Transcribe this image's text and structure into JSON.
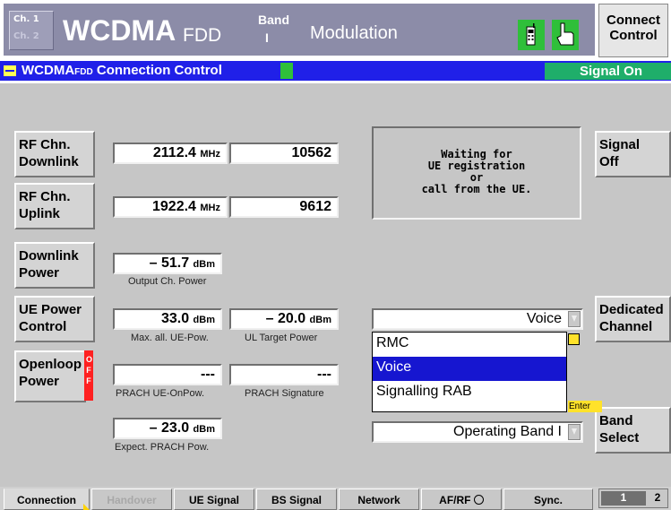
{
  "header": {
    "ch1": "Ch. 1",
    "ch2": "Ch. 2",
    "title": "WCDMA",
    "title_sub": "FDD",
    "band_label": "Band",
    "band_value": "I",
    "mode": "Modulation",
    "connect_control": "Connect Control"
  },
  "panel": {
    "title": "WCDMA",
    "title_fdd": "FDD",
    "title_rest": "Connection Control",
    "signal_state": "Signal On"
  },
  "left_buttons": {
    "rf_downlink": "RF Chn. Downlink",
    "rf_uplink": "RF Chn. Uplink",
    "downlink_power": "Downlink Power",
    "ue_power_control": "UE Power Control",
    "openloop_power": "Openloop Power",
    "openloop_state": "OFF"
  },
  "values": {
    "dl_freq": "2112.4",
    "dl_freq_unit": "MHz",
    "dl_chn": "10562",
    "ul_freq": "1922.4",
    "ul_freq_unit": "MHz",
    "ul_chn": "9612",
    "dl_power": "– 51.7",
    "dl_power_unit": "dBm",
    "dl_power_caption": "Output Ch. Power",
    "max_ue_pow": "33.0",
    "max_ue_pow_unit": "dBm",
    "max_ue_pow_caption": "Max. all. UE-Pow.",
    "ul_target": "– 20.0",
    "ul_target_unit": "dBm",
    "ul_target_caption": "UL Target Power",
    "prach_onpow": "---",
    "prach_onpow_caption": "PRACH UE-OnPow.",
    "prach_sig": "---",
    "prach_sig_caption": "PRACH Signature",
    "exp_prach": "– 23.0",
    "exp_prach_unit": "dBm",
    "exp_prach_caption": "Expect. PRACH Pow."
  },
  "message": {
    "line1": "Waiting for",
    "line2": "UE registration",
    "line3": "or",
    "line4": "call from the UE."
  },
  "right_buttons": {
    "signal_off": "Signal Off",
    "dedicated_channel": "Dedicated Channel",
    "band_select": "Band Select"
  },
  "dropdowns": {
    "channel_type_selected": "Voice",
    "channel_type_options": [
      "RMC",
      "Voice",
      "Signalling RAB"
    ],
    "band_selected": "Operating Band I",
    "enter_hint": "Enter"
  },
  "tabs": [
    "Connection",
    "Handover",
    "UE Signal",
    "BS Signal",
    "Network",
    "AF/RF",
    "Sync."
  ],
  "pages": [
    "1",
    "2"
  ]
}
